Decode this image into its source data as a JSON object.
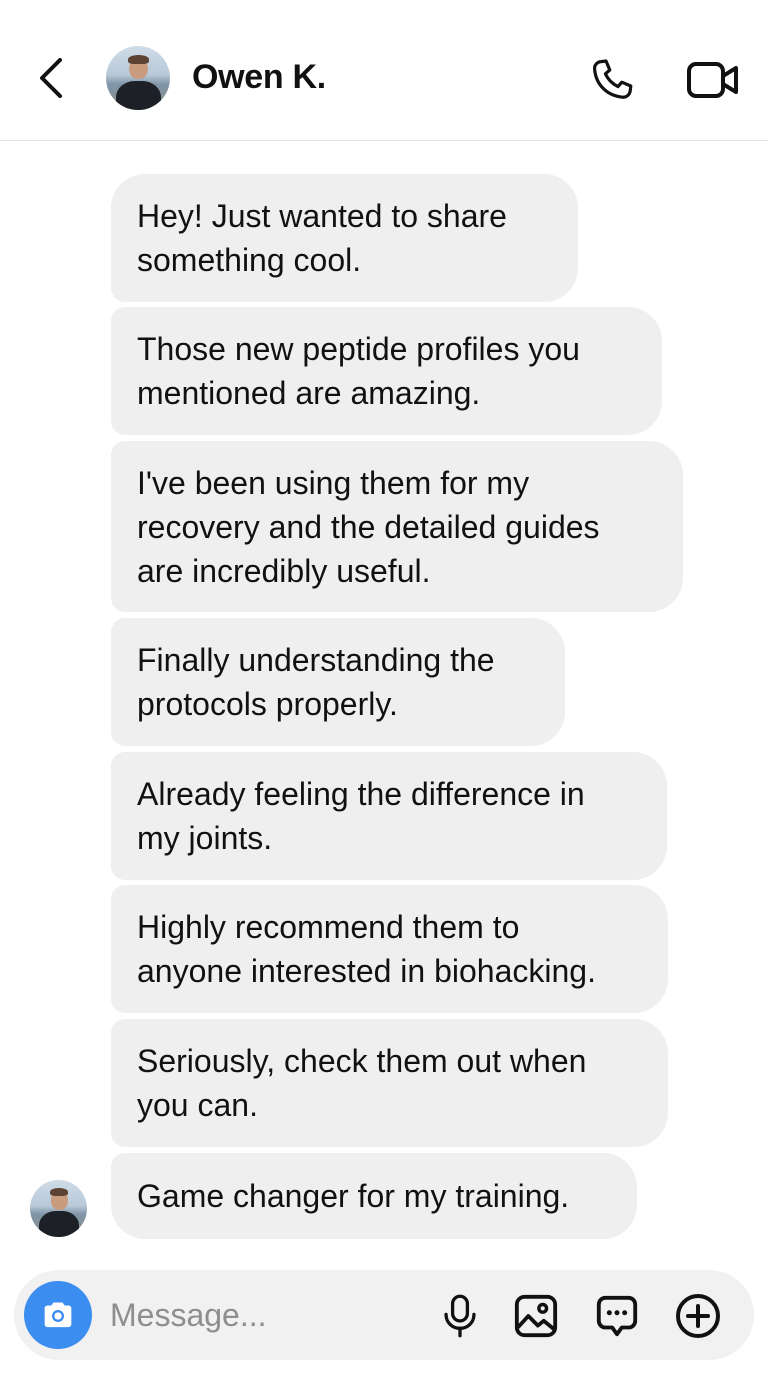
{
  "header": {
    "contact_name": "Owen K.",
    "back_icon": "chevron-left-icon",
    "call_icon": "phone-icon",
    "video_icon": "video-camera-icon"
  },
  "messages": [
    {
      "text": "Hey! Just wanted to share\nsomething cool."
    },
    {
      "text": "Those new peptide profiles you\nmentioned are amazing."
    },
    {
      "text": "I've been using them for my\nrecovery and the detailed guides\nare incredibly useful."
    },
    {
      "text": "Finally understanding the\nprotocols properly."
    },
    {
      "text": "Already feeling the difference in\nmy joints."
    },
    {
      "text": "Highly recommend them to\nanyone interested in biohacking."
    },
    {
      "text": "Seriously, check them out when\nyou can."
    },
    {
      "text": "Game changer for my training."
    }
  ],
  "composer": {
    "placeholder": "Message...",
    "camera_icon": "camera-icon",
    "mic_icon": "microphone-icon",
    "gallery_icon": "image-icon",
    "sticker_icon": "chat-bubble-icon",
    "plus_icon": "plus-circle-icon",
    "accent_color": "#3b8ef0"
  },
  "colors": {
    "bubble": "#efefef",
    "text": "#111111",
    "divider": "#e3e3e3"
  }
}
